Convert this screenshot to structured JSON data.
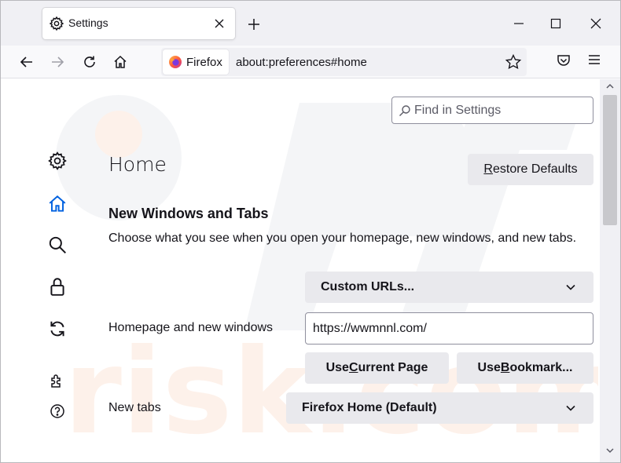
{
  "tab": {
    "title": "Settings"
  },
  "toolbar": {
    "identity_label": "Firefox",
    "url": "about:preferences#home"
  },
  "search": {
    "placeholder": "Find in Settings"
  },
  "page": {
    "title": "Home",
    "restore_pre": "",
    "restore_accel": "R",
    "restore_post": "estore Defaults"
  },
  "section": {
    "title": "New Windows and Tabs",
    "description": "Choose what you see when you open your homepage, new windows, and new tabs."
  },
  "homepage": {
    "select_value": "Custom URLs...",
    "label": "Homepage and new windows",
    "url_value": "https://wwmnnl.com/",
    "use_current_pre": "Use ",
    "use_current_accel": "C",
    "use_current_post": "urrent Page",
    "use_bookmark_pre": "Use ",
    "use_bookmark_accel": "B",
    "use_bookmark_post": "ookmark..."
  },
  "newtabs": {
    "label": "New tabs",
    "select_value": "Firefox Home (Default)"
  },
  "sidebar": {
    "items": [
      {
        "icon": "gear-icon"
      },
      {
        "icon": "home-icon"
      },
      {
        "icon": "search-icon"
      },
      {
        "icon": "lock-icon"
      },
      {
        "icon": "sync-icon"
      },
      {
        "icon": "extensions-icon"
      },
      {
        "icon": "help-icon"
      }
    ]
  },
  "colors": {
    "accent": "#0061e0",
    "button_bg": "#e9e9ed",
    "tabstrip_bg": "#f0f0f4"
  }
}
